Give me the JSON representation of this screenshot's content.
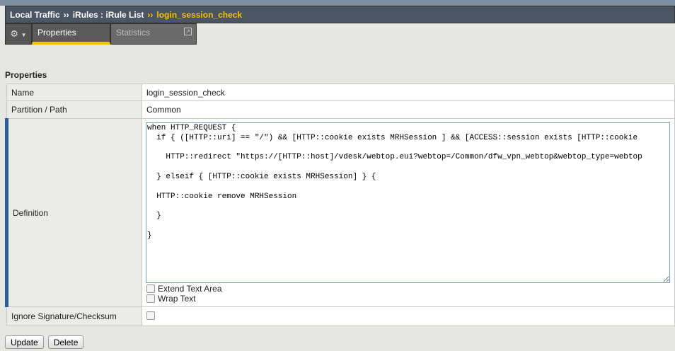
{
  "breadcrumb": {
    "items": [
      "Local Traffic",
      "iRules : iRule List"
    ],
    "separator": "››",
    "current": "login_session_check"
  },
  "tabs": [
    {
      "label": "Properties",
      "active": true
    },
    {
      "label": "Statistics",
      "active": false
    }
  ],
  "section_title": "Properties",
  "fields": {
    "name": {
      "label": "Name",
      "value": "login_session_check"
    },
    "partition": {
      "label": "Partition / Path",
      "value": "Common"
    },
    "definition": {
      "label": "Definition",
      "value": "when HTTP_REQUEST {\n  if { ([HTTP::uri] == \"/\") && [HTTP::cookie exists MRHSession ] && [ACCESS::session exists [HTTP::cookie\n\n    HTTP::redirect \"https://[HTTP::host]/vdesk/webtop.eui?webtop=/Common/dfw_vpn_webtop&webtop_type=webtop\n\n  } elseif { [HTTP::cookie exists MRHSession] } {\n\n  HTTP::cookie remove MRHSession\n\n  }\n\n}"
    },
    "extend_text_area": "Extend Text Area",
    "wrap_text": "Wrap Text",
    "ignore_signature": {
      "label": "Ignore Signature/Checksum",
      "checked": false
    }
  },
  "buttons": {
    "update": "Update",
    "delete": "Delete"
  }
}
